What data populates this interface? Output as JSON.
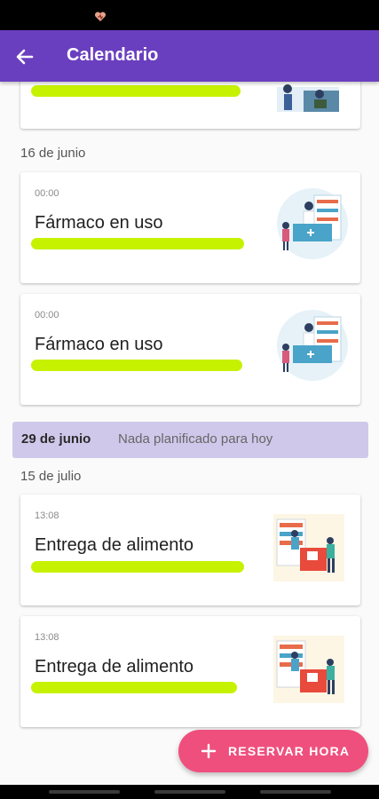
{
  "app_bar": {
    "title": "Calendario",
    "back_icon": "arrow-back-icon"
  },
  "colors": {
    "app_bar": "#6a3fbf",
    "fab": "#ef4f7d",
    "today_bar": "#d0c8ea",
    "highlight": "#c6f200"
  },
  "top_card": {
    "illustration": "people-illustration"
  },
  "groups": [
    {
      "date": "16 de junio",
      "cards": [
        {
          "time": "00:00",
          "title": "Fármaco en uso",
          "illustration": "pharmacy-illustration"
        },
        {
          "time": "00:00",
          "title": "Fármaco en uso",
          "illustration": "pharmacy-illustration"
        }
      ]
    },
    {
      "date": "15 de julio",
      "cards": [
        {
          "time": "13:08",
          "title": "Entrega de alimento",
          "illustration": "food-delivery-illustration"
        },
        {
          "time": "13:08",
          "title": "Entrega de alimento",
          "illustration": "food-delivery-illustration"
        }
      ]
    }
  ],
  "today": {
    "date": "29 de junio",
    "message": "Nada planificado para hoy"
  },
  "fab": {
    "label": "RESERVAR HORA",
    "icon": "plus-icon"
  }
}
